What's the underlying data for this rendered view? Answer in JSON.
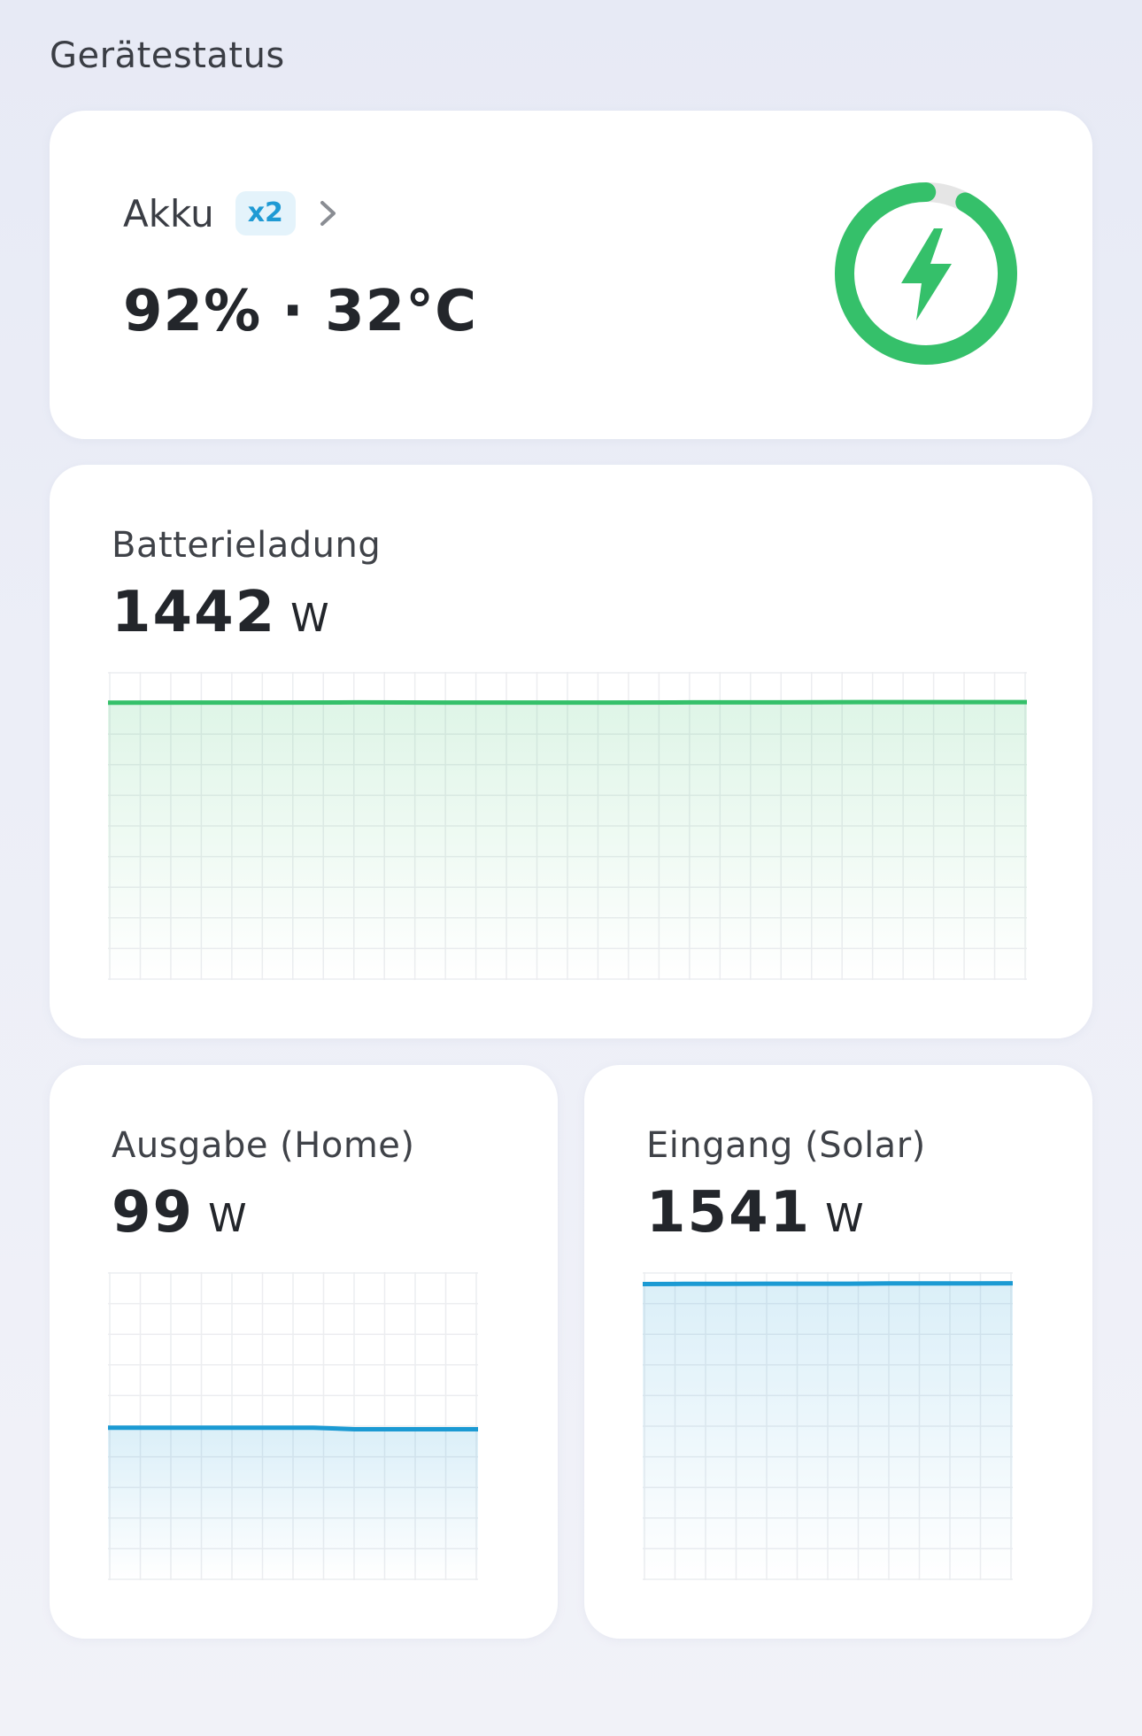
{
  "section": {
    "title": "Gerätestatus"
  },
  "battery": {
    "label": "Akku",
    "badge": "x2",
    "summary": "92% · 32°C",
    "charge_percent": 92,
    "ring_color": "#35c06a",
    "ring_track_color": "#e5e5e5",
    "icon": "lightning-bolt-icon"
  },
  "charge": {
    "title": "Batterieladung",
    "value": "1442",
    "unit": "W",
    "color": "#35c06a"
  },
  "output": {
    "title": "Ausgabe (Home)",
    "value": "99",
    "unit": "W",
    "color": "#1b9ad3"
  },
  "input": {
    "title": "Eingang (Solar)",
    "value": "1541",
    "unit": "W",
    "color": "#1b9ad3"
  },
  "chart_data": [
    {
      "type": "area",
      "series": [
        {
          "values": [
            1440,
            1441,
            1441,
            1442,
            1441,
            1441,
            1441,
            1442,
            1442,
            1443,
            1443,
            1443
          ]
        }
      ],
      "ylim": [
        0,
        1600
      ],
      "grid": true
    },
    {
      "type": "area",
      "series": [
        {
          "values": [
            99,
            99,
            99,
            99,
            99,
            99,
            98,
            98,
            98,
            98
          ]
        }
      ],
      "ylim": [
        0,
        200
      ],
      "grid": true
    },
    {
      "type": "area",
      "series": [
        {
          "values": [
            1538,
            1539,
            1539,
            1540,
            1540,
            1540,
            1541,
            1541,
            1541,
            1542
          ]
        }
      ],
      "ylim": [
        0,
        1600
      ],
      "grid": true
    }
  ]
}
